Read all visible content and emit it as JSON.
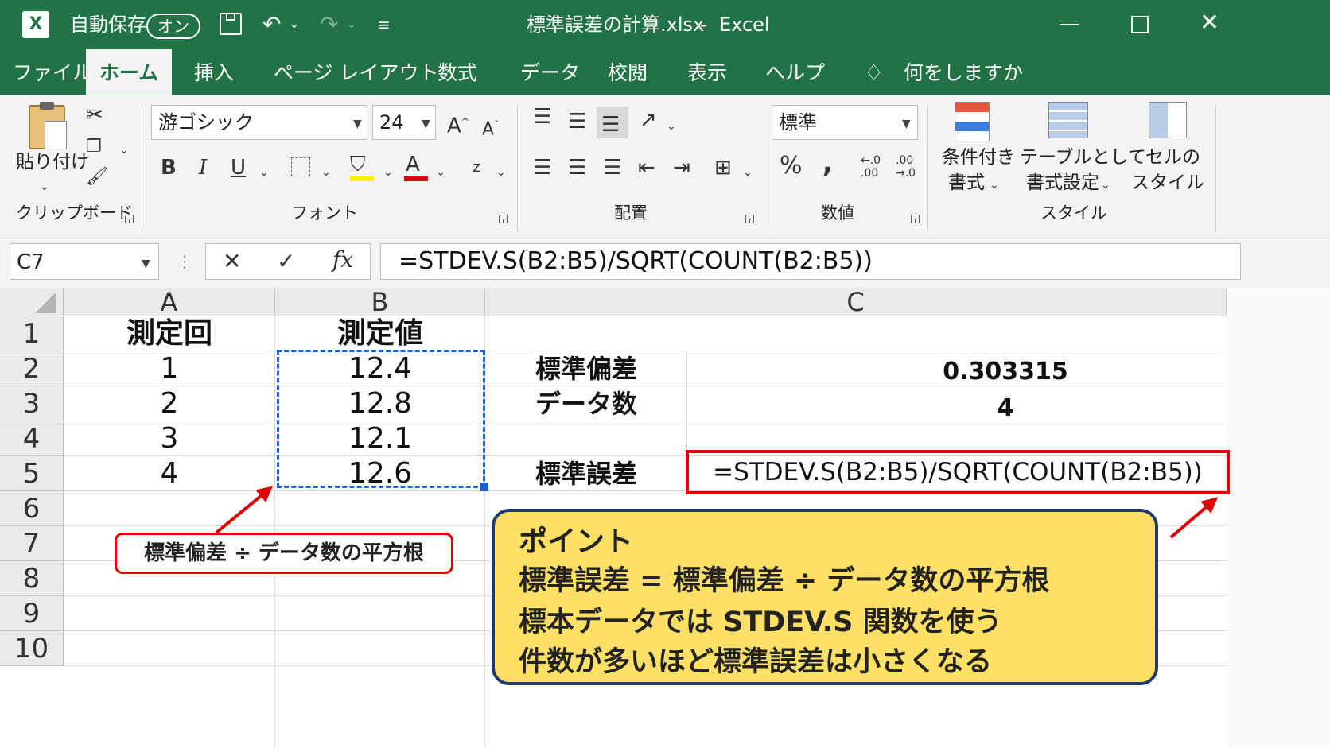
{
  "titlebar": {
    "autosave_label": "自動保存",
    "autosave_toggle": "オン",
    "filename": "標準誤差の計算.xlsx",
    "separator": "-",
    "app": "Excel"
  },
  "menu": {
    "file": "ファイル",
    "home": "ホーム",
    "insert": "挿入",
    "page_layout": "ページ レイアウト",
    "formulas": "数式",
    "data": "データ",
    "review": "校閲",
    "view": "表示",
    "help": "ヘルプ",
    "tell_me": "何をしますか"
  },
  "ribbon": {
    "clipboard": {
      "paste": "貼り付け",
      "group": "クリップボード"
    },
    "font": {
      "name": "游ゴシック",
      "size": "24",
      "bold": "B",
      "italic": "I",
      "underline": "U",
      "font_color": "A",
      "group": "フォント"
    },
    "alignment": {
      "group": "配置"
    },
    "number": {
      "format": "標準",
      "percent": "%",
      "comma": ",",
      "group": "数値"
    },
    "styles": {
      "conditional_line1": "条件付き",
      "conditional_line2": "書式",
      "table_line1": "テーブルとして",
      "table_line2": "書式設定",
      "cell_line1": "セルの",
      "cell_line2": "スタイル",
      "group": "スタイル"
    }
  },
  "formula_bar": {
    "name_box": "C7",
    "fx": "fx",
    "formula": "=STDEV.S(B2:B5)/SQRT(COUNT(B2:B5))"
  },
  "sheet": {
    "columns": [
      "A",
      "B",
      "C"
    ],
    "rows": [
      "1",
      "2",
      "3",
      "4",
      "5",
      "6",
      "7",
      "8",
      "9",
      "10"
    ],
    "a1": "測定回",
    "b1": "測定値",
    "a2": "1",
    "a3": "2",
    "a4": "3",
    "a5": "4",
    "b2": "12.4",
    "b3": "12.8",
    "b4": "12.1",
    "b5": "12.6",
    "c2_label": "標準偏差",
    "c2_value": "0.303315",
    "c3_label": "データ数",
    "c3_value": "4",
    "c5_label": "標準誤差",
    "c5_formula": "=STDEV.S(B2:B5)/SQRT(COUNT(B2:B5))"
  },
  "annotations": {
    "callout": "標準偏差 ÷ データ数の平方根",
    "point_title": "ポイント",
    "point_1": "標準誤差 = 標準偏差 ÷ データ数の平方根",
    "point_2": "標本データでは STDEV.S 関数を使う",
    "point_3": "件数が多いほど標準誤差は小さくなる",
    "red": "#e00000",
    "point_bg": "#ffe066",
    "point_border": "#1f3a6e",
    "selection_blue": "#1a5fd6",
    "excel_green": "#217346"
  }
}
